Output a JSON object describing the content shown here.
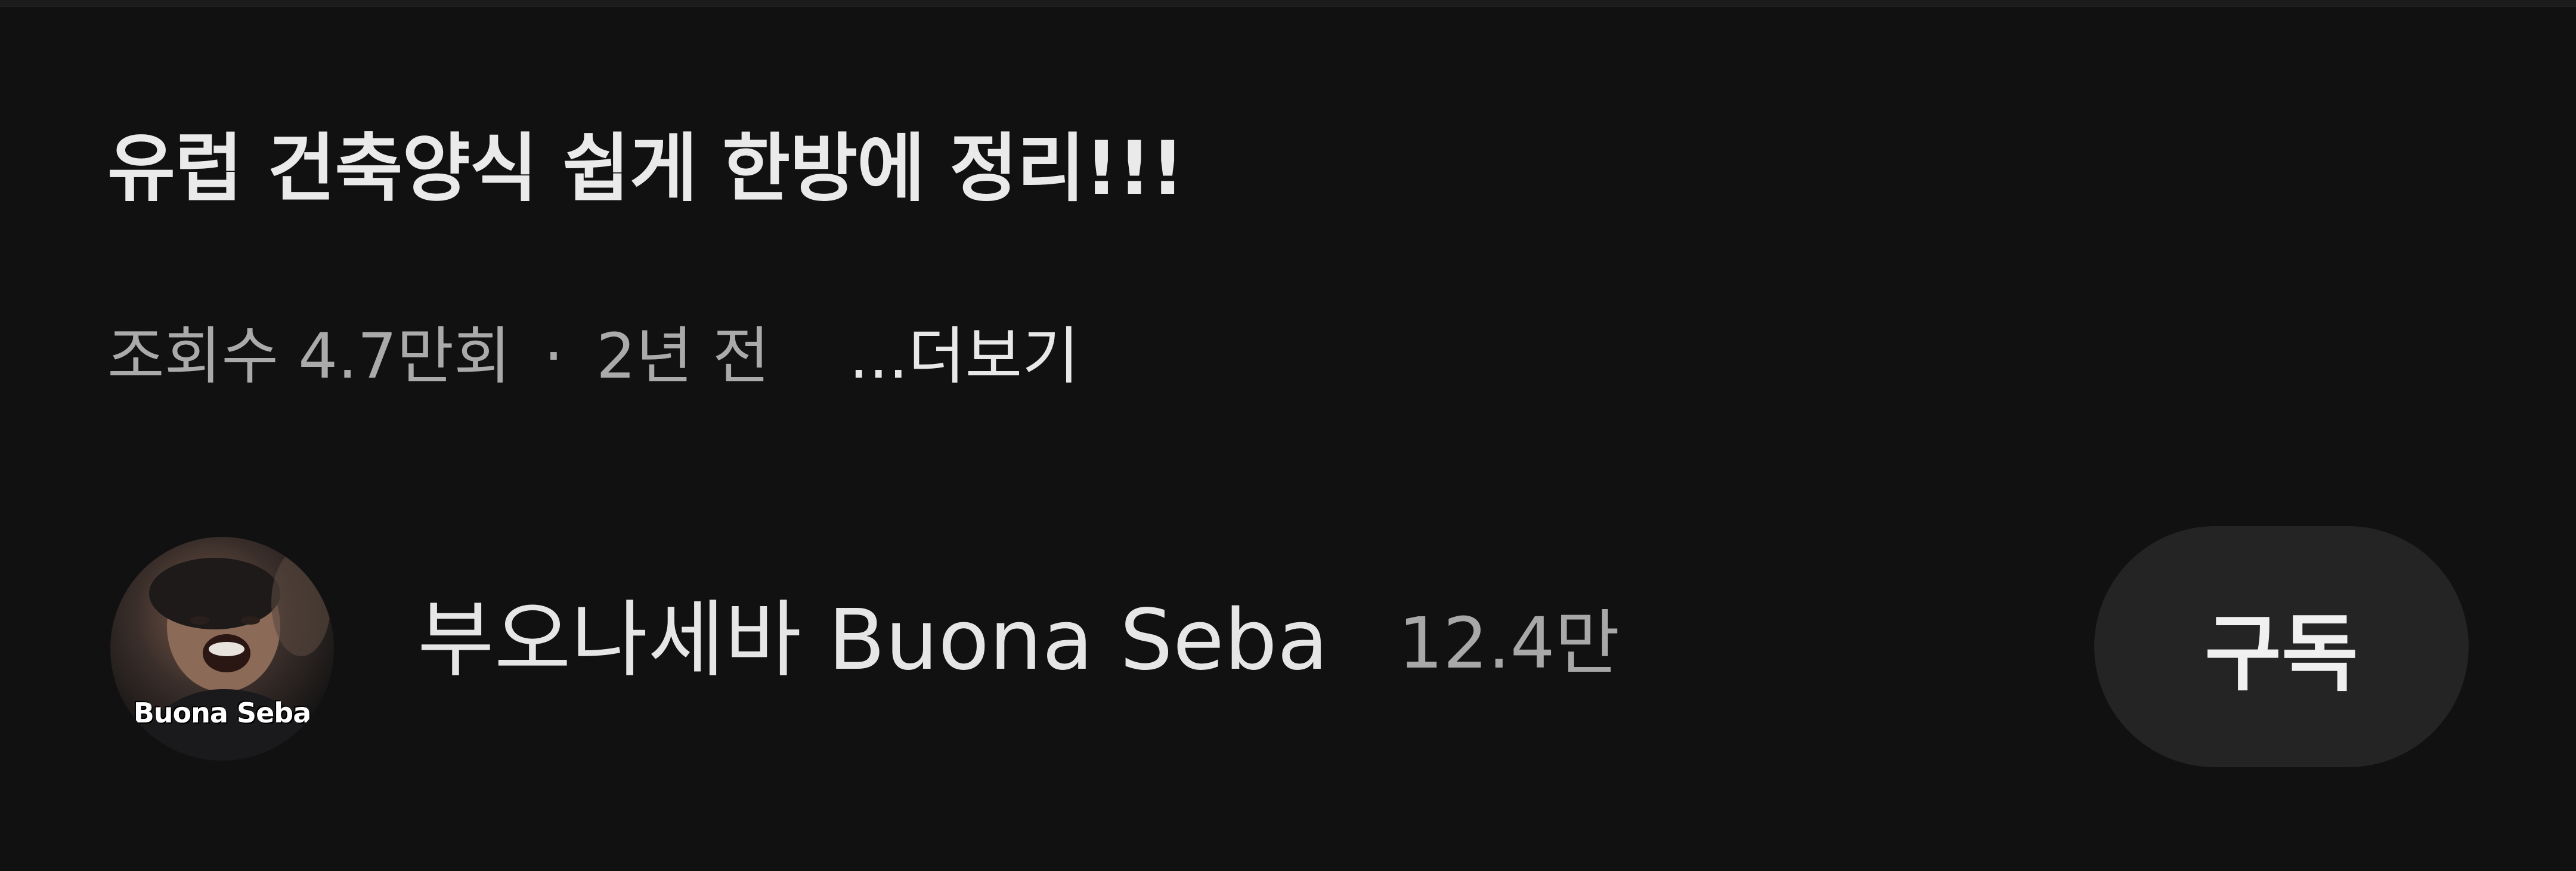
{
  "video": {
    "title": "유럽 건축양식 쉽게 한방에 정리!!!",
    "views": "조회수 4.7만회",
    "separator": "·",
    "age": "2년 전",
    "more_label": "...더보기"
  },
  "channel": {
    "name": "부오나세바 Buona Seba",
    "subscribers": "12.4만",
    "avatar_logo_text": "Buona Seba"
  },
  "subscribe": {
    "label": "구독"
  },
  "colors": {
    "background": "#121112",
    "button_bg": "#242424",
    "secondary_text": "#aaaaaa"
  }
}
